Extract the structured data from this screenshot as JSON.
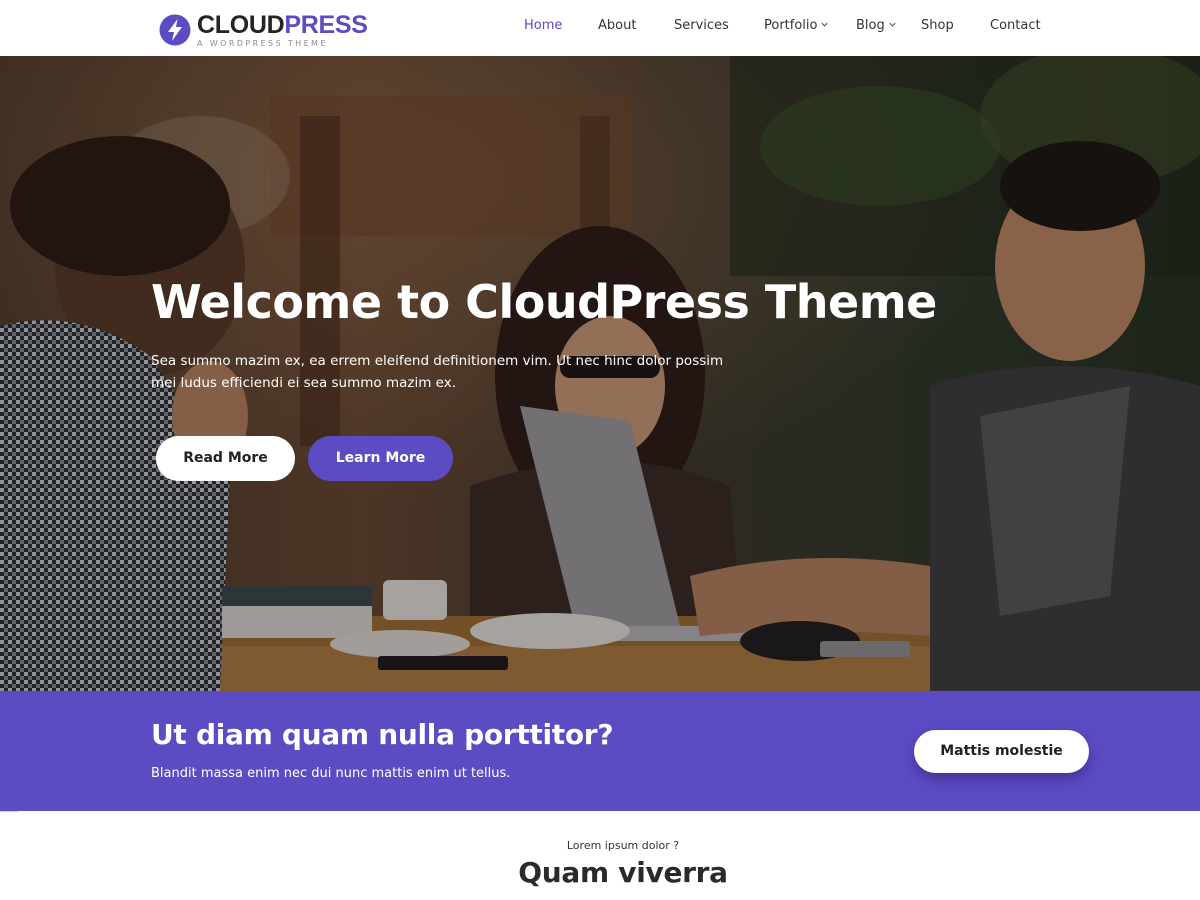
{
  "brand": {
    "name_part1": "CLOUD",
    "name_part2": "PRESS",
    "tagline": "A WORDPRESS THEME",
    "logo_icon": "lightning-bolt-icon",
    "accent_color": "#5b4cc4"
  },
  "nav": {
    "items": [
      {
        "label": "Home",
        "active": true
      },
      {
        "label": "About"
      },
      {
        "label": "Services"
      },
      {
        "label": "Portfolio",
        "has_dropdown": true
      },
      {
        "label": "Blog",
        "has_dropdown": true
      },
      {
        "label": "Shop"
      },
      {
        "label": "Contact"
      }
    ]
  },
  "hero": {
    "title": "Welcome to CloudPress Theme",
    "text": "Sea summo mazim ex, ea errem eleifend definitionem vim. Ut nec hinc dolor possim mei ludus efficiendi ei sea summo mazim ex.",
    "read_more": "Read More",
    "learn_more": "Learn More"
  },
  "cta": {
    "title": "Ut diam quam nulla porttitor?",
    "subtitle": "Blandit massa enim nec dui nunc mattis enim ut tellus.",
    "button": "Mattis molestie",
    "background_color": "#5b4cc4"
  },
  "section": {
    "kicker": "Lorem ipsum dolor ?",
    "title": "Quam viverra"
  }
}
